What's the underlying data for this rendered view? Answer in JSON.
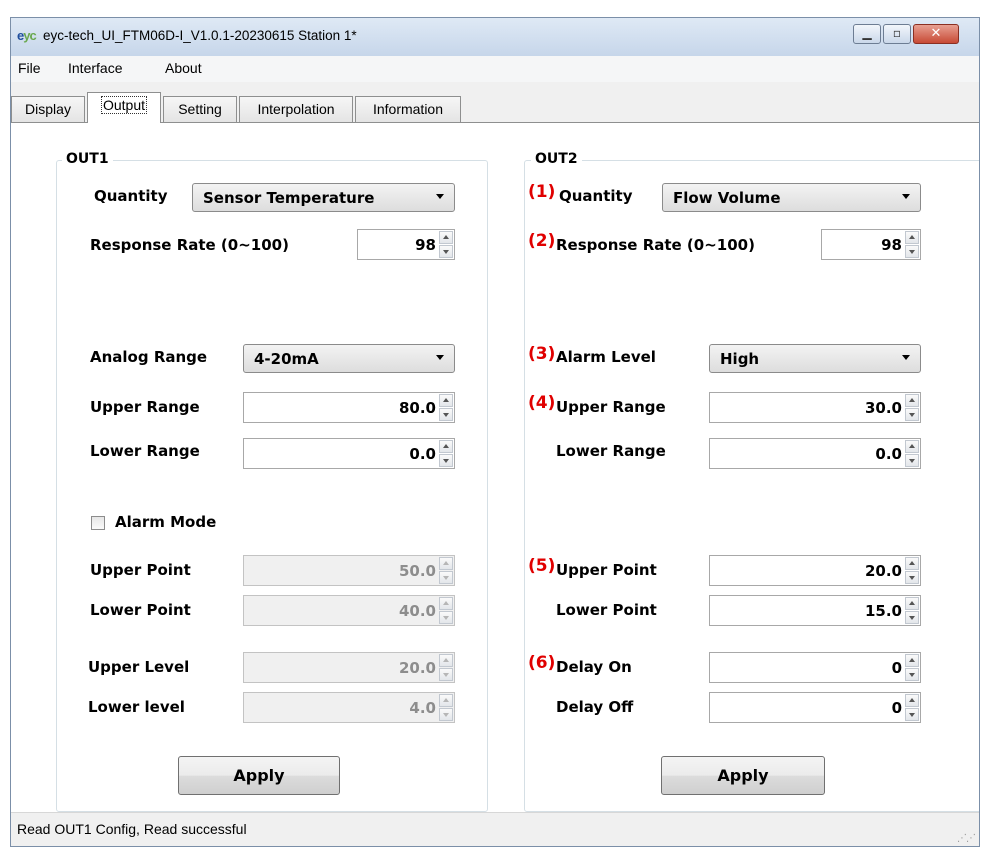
{
  "window": {
    "title": "eyc-tech_UI_FTM06D-I_V1.0.1-20230615  Station 1*",
    "icon": "eyc-logo-icon",
    "icon_text_a": "e",
    "icon_text_b": "yc"
  },
  "menu": {
    "file": "File",
    "interface": "Interface",
    "about": "About"
  },
  "tabs": [
    {
      "label": "Display"
    },
    {
      "label": "Output",
      "active": true
    },
    {
      "label": "Setting"
    },
    {
      "label": "Interpolation"
    },
    {
      "label": "Information"
    }
  ],
  "out1": {
    "title": "OUT1",
    "quantity_label": "Quantity",
    "quantity_value": "Sensor Temperature",
    "response_label": "Response Rate (0~100)",
    "response_value": "98",
    "analog_label": "Analog Range",
    "analog_value": "4-20mA",
    "upper_range_label": "Upper Range",
    "upper_range_value": "80.0",
    "lower_range_label": "Lower Range",
    "lower_range_value": "0.0",
    "alarm_mode_label": "Alarm Mode",
    "alarm_mode_checked": false,
    "upper_point_label": "Upper Point",
    "upper_point_value": "50.0",
    "lower_point_label": "Lower Point",
    "lower_point_value": "40.0",
    "upper_level_label": "Upper Level",
    "upper_level_value": "20.0",
    "lower_level_label": "Lower level",
    "lower_level_value": "4.0",
    "apply_label": "Apply"
  },
  "out2": {
    "title": "OUT2",
    "markers": [
      "(1)",
      "(2)",
      "(3)",
      "(4)",
      "(5)",
      "(6)"
    ],
    "marker_color": "#e00000",
    "quantity_label": "Quantity",
    "quantity_value": "Flow Volume",
    "response_label": "Response Rate (0~100)",
    "response_value": "98",
    "alarm_level_label": "Alarm Level",
    "alarm_level_value": "High",
    "upper_range_label": "Upper Range",
    "upper_range_value": "30.0",
    "lower_range_label": "Lower Range",
    "lower_range_value": "0.0",
    "upper_point_label": "Upper Point",
    "upper_point_value": "20.0",
    "lower_point_label": "Lower Point",
    "lower_point_value": "15.0",
    "delay_on_label": "Delay On",
    "delay_on_value": "0",
    "delay_off_label": "Delay Off",
    "delay_off_value": "0",
    "apply_label": "Apply"
  },
  "status": {
    "text": "Read OUT1 Config,   Read successful"
  }
}
